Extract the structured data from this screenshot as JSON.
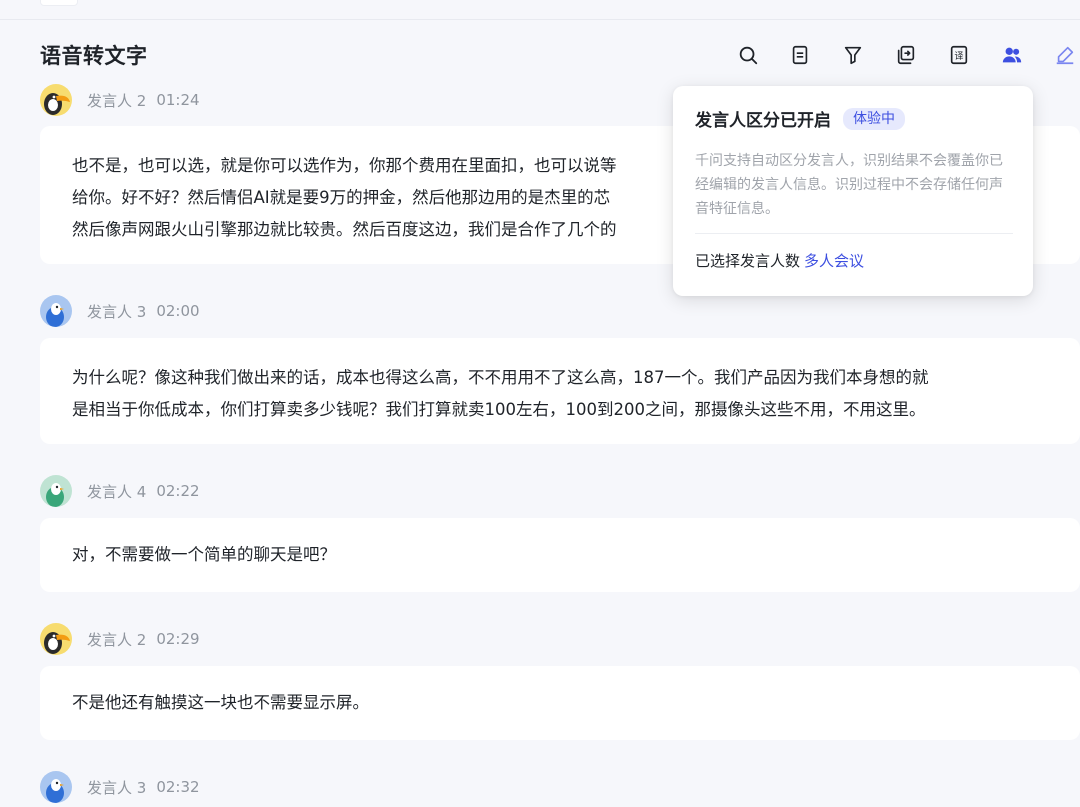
{
  "header": {
    "title": "语音转文字",
    "tools": [
      {
        "name": "search-icon"
      },
      {
        "name": "document-icon"
      },
      {
        "name": "filter-icon"
      },
      {
        "name": "export-icon"
      },
      {
        "name": "translate-icon",
        "label": "译"
      },
      {
        "name": "speakers-icon",
        "active": true
      },
      {
        "name": "edit-icon"
      }
    ]
  },
  "popup": {
    "title": "发言人区分已开启",
    "badge": "体验中",
    "description": "千问支持自动区分发言人，识别结果不会覆盖你已经编辑的发言人信息。识别过程中不会存储任何声音特征信息。",
    "footer_label": "已选择发言人数",
    "footer_link": "多人会议"
  },
  "transcript": [
    {
      "speaker": "发言人 2",
      "time": "01:24",
      "avatar": "toucan-avatar",
      "lines": [
        "也不是，也可以选，就是你可以选作为，你那个费用在里面扣，也可以说等",
        "给你。好不好？然后情侣AI就是要9万的押金，然后他那边用的是杰里的芯",
        "然后像声网跟火山引擎那边就比较贵。然后百度这边，我们是合作了几个的"
      ]
    },
    {
      "speaker": "发言人 3",
      "time": "02:00",
      "avatar": "bird-blue-avatar",
      "lines": [
        "为什么呢？像这种我们做出来的话，成本也得这么高，不不用用不了这么高，187一个。我们产品因为我们本身想的就",
        "是相当于你低成本，你们打算卖多少钱呢？我们打算就卖100左右，100到200之间，那摄像头这些不用，不用这里。"
      ]
    },
    {
      "speaker": "发言人 4",
      "time": "02:22",
      "avatar": "bird-green-avatar",
      "lines": [
        "对，不需要做一个简单的聊天是吧？"
      ]
    },
    {
      "speaker": "发言人 2",
      "time": "02:29",
      "avatar": "toucan-avatar",
      "lines": [
        "不是他还有触摸这一块也不需要显示屏。"
      ]
    },
    {
      "speaker": "发言人 3",
      "time": "02:32",
      "avatar": "bird-blue-avatar",
      "lines": []
    }
  ],
  "colors": {
    "background": "#f6f7fb",
    "accent": "#3d4fe0",
    "muted_text": "#8f959e"
  }
}
